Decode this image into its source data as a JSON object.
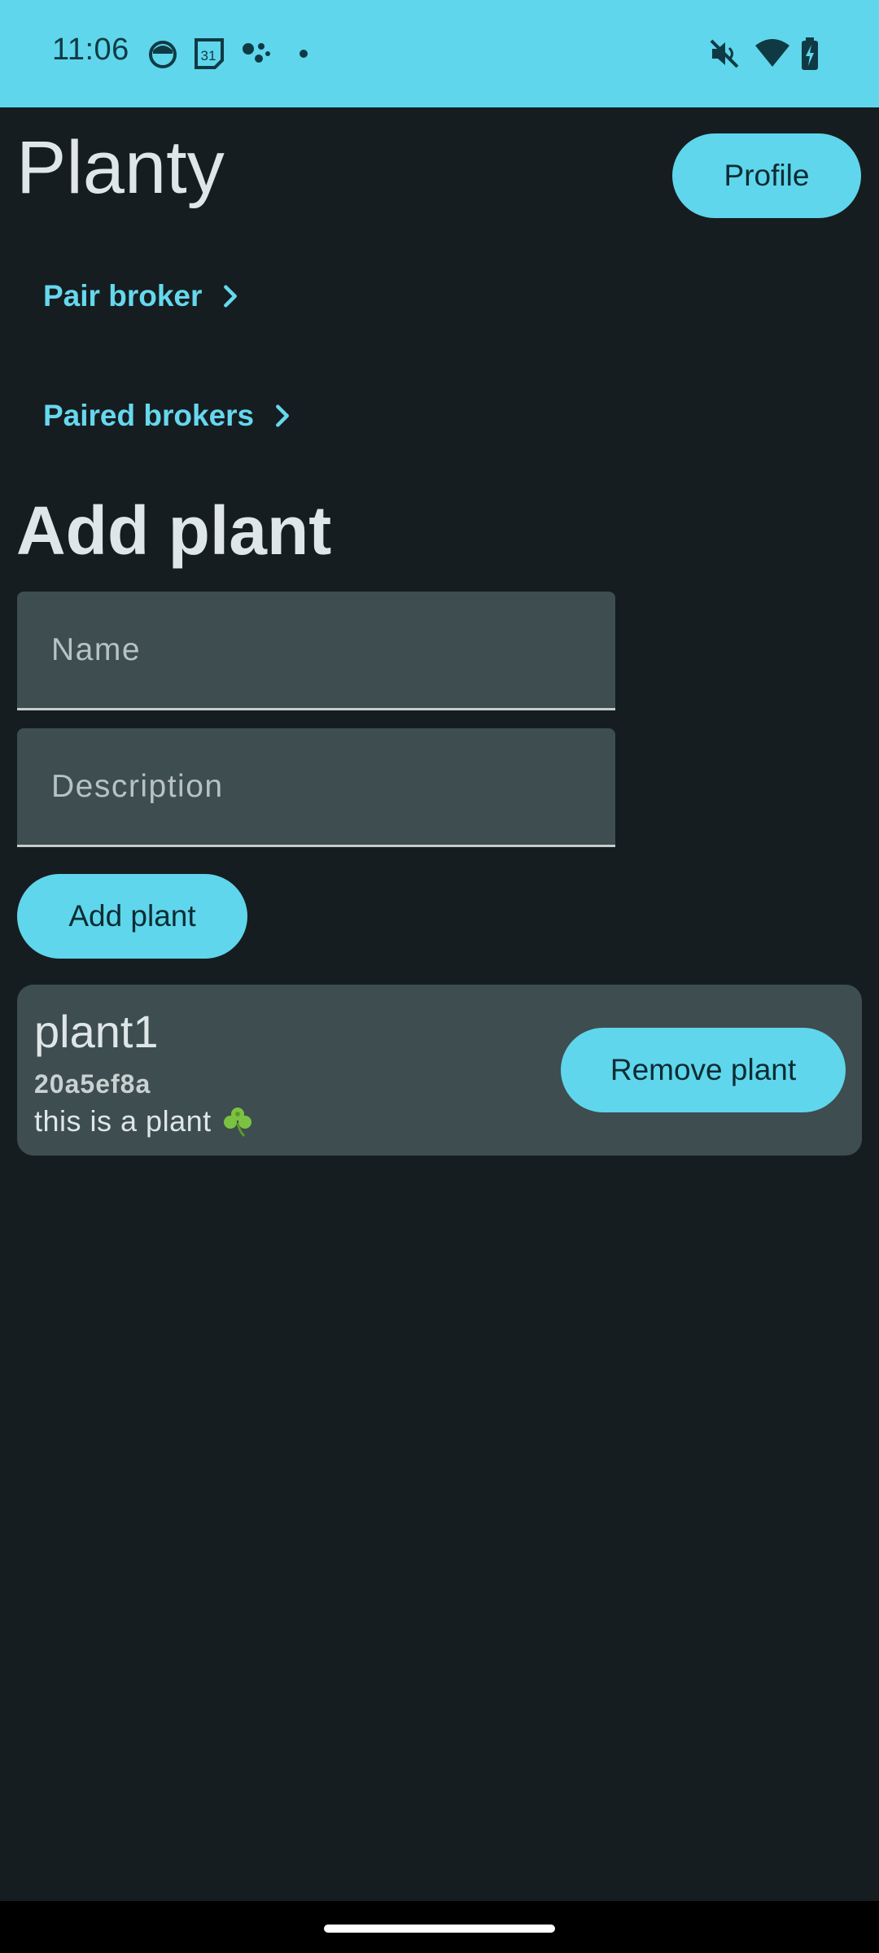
{
  "status_bar": {
    "time": "11:06",
    "calendar_day": "31",
    "icons": [
      "face-icon",
      "calendar-icon",
      "assistant-icon",
      "dot-icon",
      "mute-icon",
      "wifi-icon",
      "battery-charging-icon"
    ]
  },
  "header": {
    "title": "Planty",
    "profile_label": "Profile"
  },
  "links": {
    "pair_broker": "Pair broker",
    "paired_brokers": "Paired brokers"
  },
  "add_plant": {
    "title": "Add plant",
    "name_placeholder": "Name",
    "description_placeholder": "Description",
    "button_label": "Add plant"
  },
  "plants": [
    {
      "name": "plant1",
      "id": "20a5ef8a",
      "description": "this is a plant",
      "icon": "clover-icon",
      "remove_label": "Remove plant"
    }
  ],
  "colors": {
    "accent": "#5fd6ec",
    "background": "#161d20",
    "surface": "#3e4d4f",
    "link": "#66d8ee",
    "text": "#dfe6e8"
  }
}
